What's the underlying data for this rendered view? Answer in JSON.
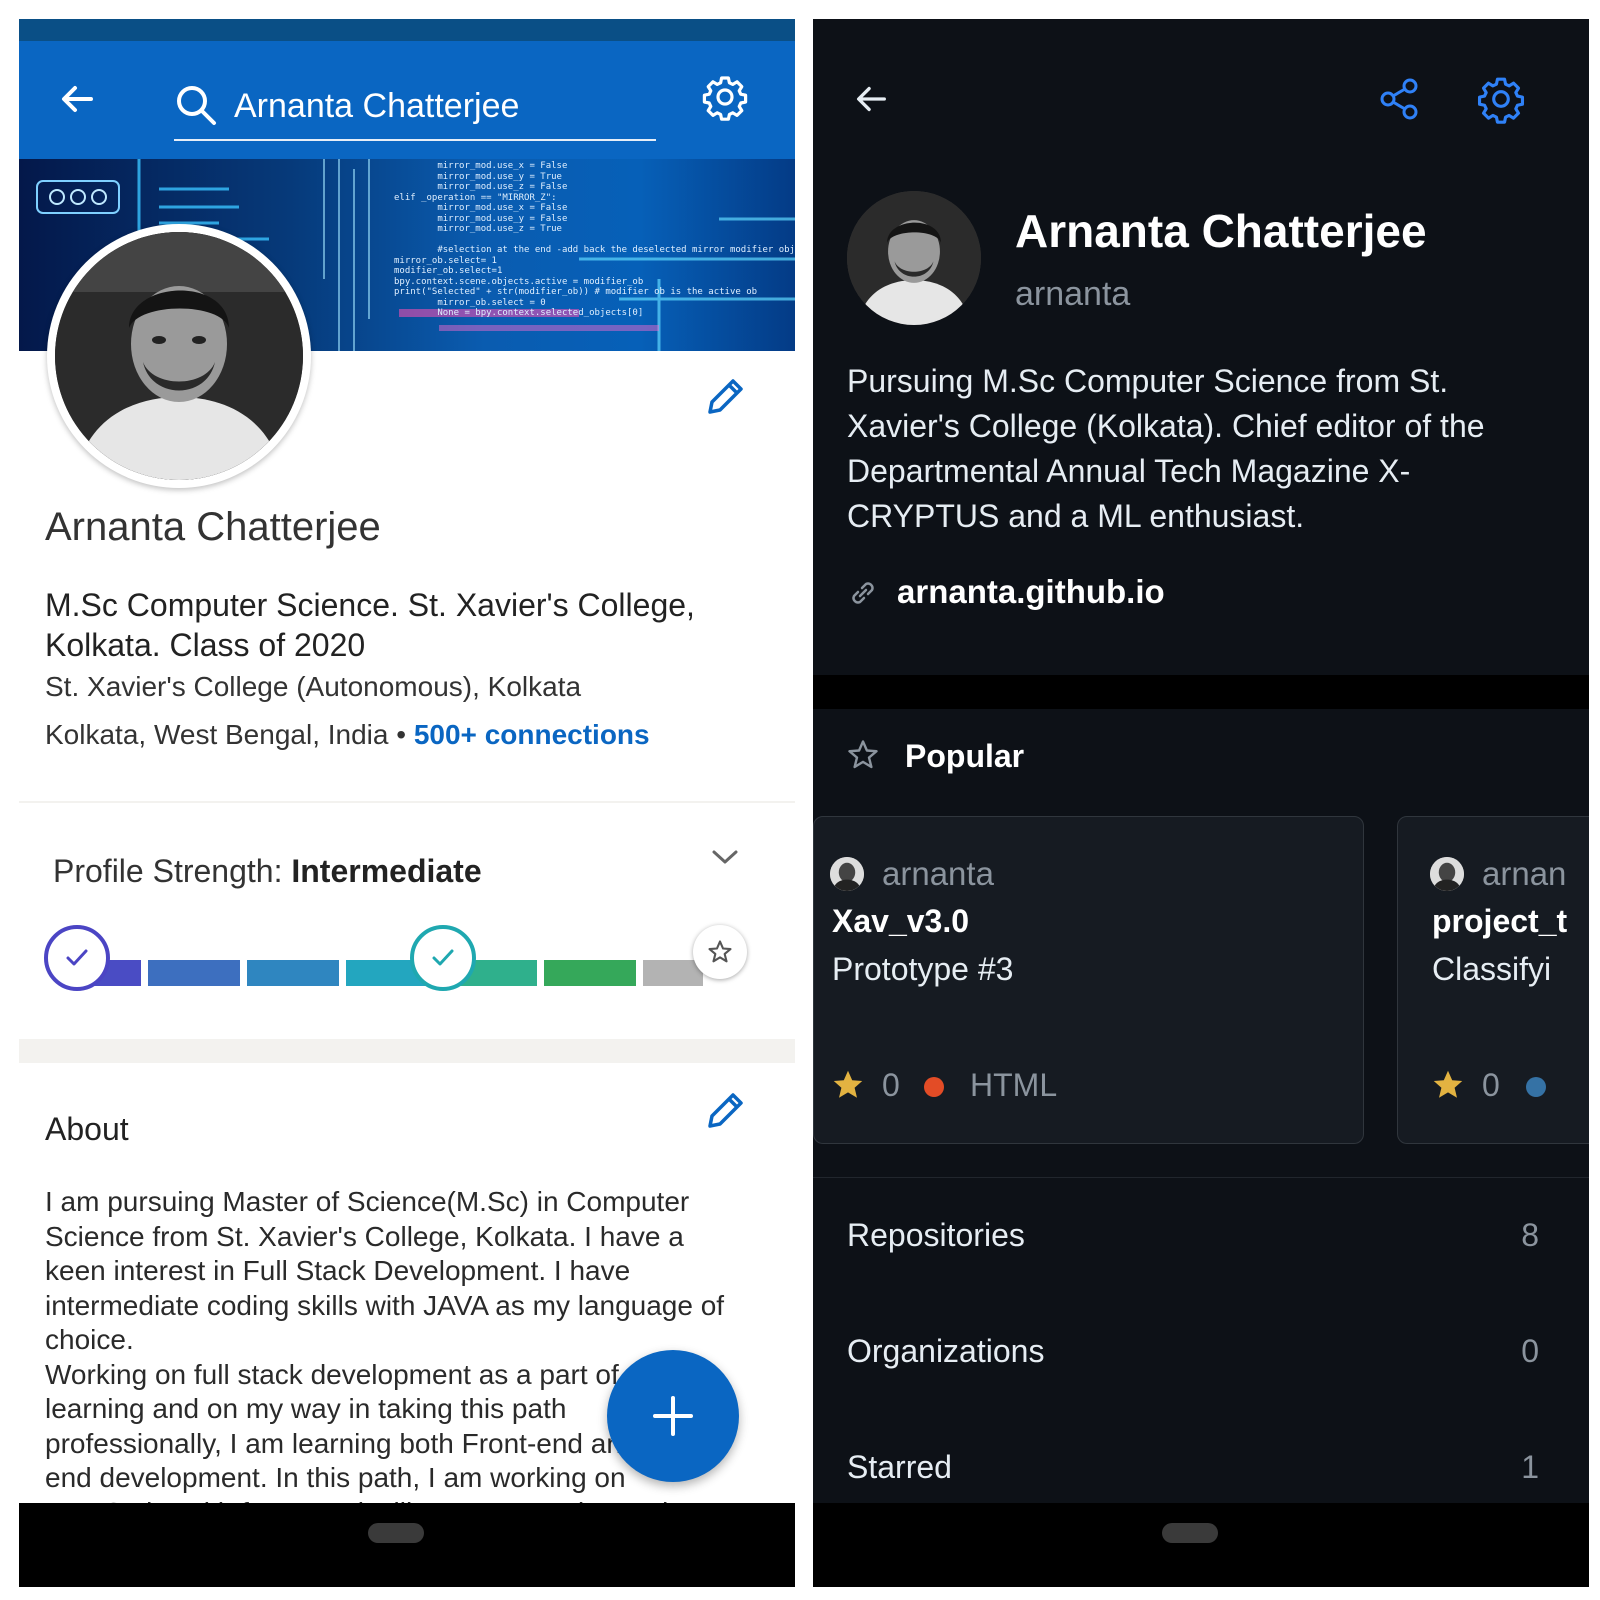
{
  "linkedin": {
    "search": {
      "query": "Arnanta Chatterjee"
    },
    "profile": {
      "name": "Arnanta Chatterjee",
      "headline": "M.Sc Computer Science. St. Xavier's College, Kolkata. Class of 2020",
      "school": "St. Xavier's College (Autonomous), Kolkata",
      "location": "Kolkata, West Bengal, India",
      "separator": "•",
      "connections": "500+ connections"
    },
    "profile_strength": {
      "label": "Profile Strength: ",
      "level": "Intermediate",
      "completed_fraction": 0.55
    },
    "about": {
      "title": "About",
      "text": "I am pursuing Master of Science(M.Sc) in Computer Science from St. Xavier's College, Kolkata. I have a keen interest in Full Stack Development. I have intermediate coding skills with JAVA as my language of choice.\nWorking on full stack development as a part of self learning and on my way in taking this path professionally, I am learning both Front-end and Back-end development. In this path, I am working on JavaScript with frameworks like React+Redux and"
    },
    "cover_code": "        mirror_mod.use_x = False\n        mirror_mod.use_y = True\n        mirror_mod.use_z = False\nelif _operation == \"MIRROR_Z\":\n        mirror_mod.use_x = False\n        mirror_mod.use_y = False\n        mirror_mod.use_z = True\n\n        #selection at the end -add back the deselected mirror modifier object\nmirror_ob.select= 1\nmodifier_ob.select=1\nbpy.context.scene.objects.active = modifier_ob\nprint(\"Selected\" + str(modifier_ob)) # modifier ob is the active ob\n        mirror_ob.select = 0\n        None = bpy.context.selected_objects[0]",
    "colors": {
      "brand": "#0a66c2",
      "link": "#0a66c2"
    }
  },
  "github": {
    "profile": {
      "name": "Arnanta Chatterjee",
      "login": "arnanta",
      "bio": "Pursuing M.Sc Computer Science from St. Xavier's College (Kolkata). Chief editor of the Departmental Annual Tech Magazine X-CRYPTUS and a ML enthusiast.",
      "website": "arnanta.github.io"
    },
    "popular": {
      "title": "Popular",
      "repos": [
        {
          "owner": "arnanta",
          "name": "Xav_v3.0",
          "description": "Prototype #3",
          "stars": "0",
          "language": "HTML",
          "language_color": "#e34c26"
        },
        {
          "owner": "arnan",
          "name": "project_t",
          "description": "Classifyi",
          "stars": "0",
          "language": "",
          "language_color": "#3572A5"
        }
      ]
    },
    "stats": [
      {
        "label": "Repositories",
        "count": "8"
      },
      {
        "label": "Organizations",
        "count": "0"
      },
      {
        "label": "Starred",
        "count": "1"
      }
    ],
    "colors": {
      "accent": "#2f81f7",
      "star": "#e3b341"
    }
  }
}
